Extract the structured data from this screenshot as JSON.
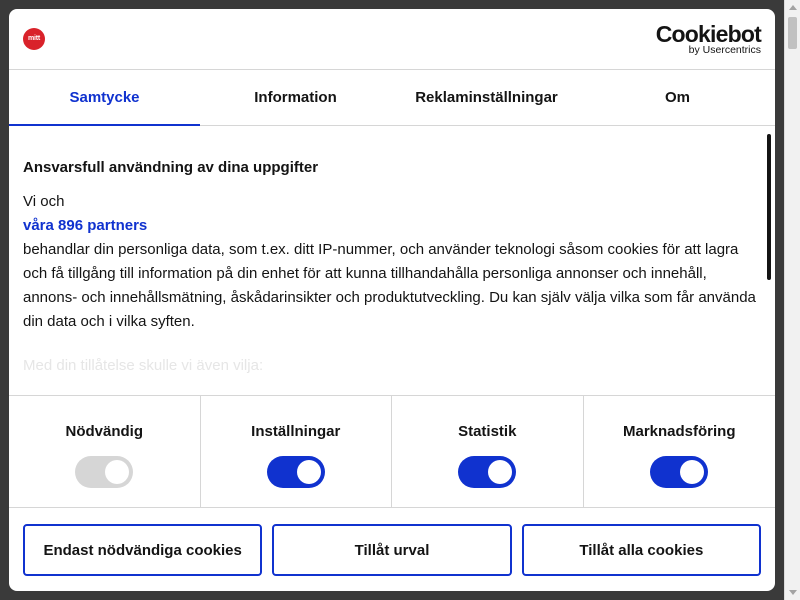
{
  "header": {
    "publisher_logo_text": "mitt",
    "cmp_brand": "Cookiebot",
    "cmp_sub": "by Usercentrics"
  },
  "tabs": [
    {
      "label": "Samtycke",
      "active": true
    },
    {
      "label": "Information",
      "active": false
    },
    {
      "label": "Reklaminställningar",
      "active": false
    },
    {
      "label": "Om",
      "active": false
    }
  ],
  "content": {
    "title": "Ansvarsfull användning av dina uppgifter",
    "intro": "Vi och",
    "partners_link": "våra 896 partners",
    "body": "behandlar din personliga data, som t.ex. ditt IP-nummer, och använder teknologi såsom cookies för att lagra och få tillgång till information på din enhet för att kunna tillhandahålla personliga annonser och innehåll, annons- och innehållsmätning, åskådarinsikter och produktutveckling. Du kan själv välja vilka som får använda din data och i vilka syften.",
    "faded": "Med din tillåtelse skulle vi även vilja:"
  },
  "toggles": [
    {
      "label": "Nödvändig",
      "state": "on",
      "disabled": true
    },
    {
      "label": "Inställningar",
      "state": "on",
      "disabled": false
    },
    {
      "label": "Statistik",
      "state": "on",
      "disabled": false
    },
    {
      "label": "Marknadsföring",
      "state": "on",
      "disabled": false
    }
  ],
  "buttons": {
    "necessary_only": "Endast nödvändiga cookies",
    "allow_selection": "Tillåt urval",
    "allow_all": "Tillåt alla cookies"
  },
  "colors": {
    "accent": "#1032cf",
    "text": "#141414",
    "publisher_red": "#d9222a",
    "disabled_switch": "#d6d6d6"
  }
}
